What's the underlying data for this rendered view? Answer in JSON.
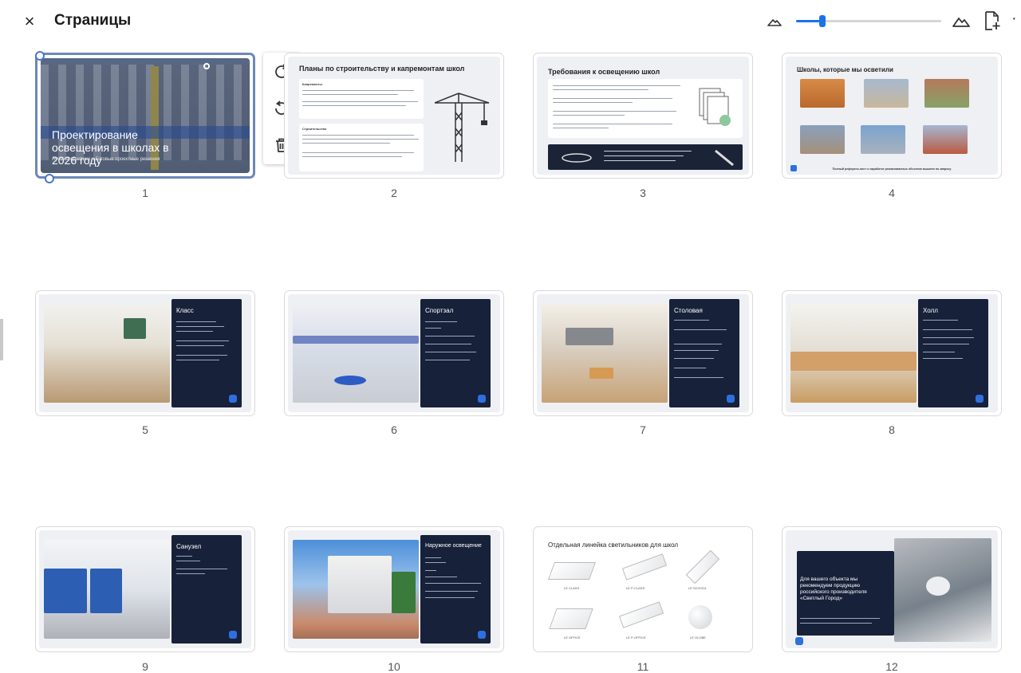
{
  "header": {
    "close_label": "×",
    "title": "Страницы",
    "zoom_level": 0.18
  },
  "menu": [
    "rotate-clockwise",
    "rotate-counterclockwise",
    "delete"
  ],
  "pages": [
    {
      "number": "1",
      "title": "Проектирование освещения в школах в 2026 году",
      "subtitle": "Лучшие практики и Готовые проектные решения"
    },
    {
      "number": "2",
      "title": "Планы по строительству и капремонтам школ",
      "sections": [
        "Капремонты",
        "Строительство"
      ]
    },
    {
      "number": "3",
      "title": "Требования к освещению школ"
    },
    {
      "number": "4",
      "title": "Школы, которые мы осветили",
      "footer": "Полный референс-лист о наработке реализованных объектов вышлем по запросу"
    },
    {
      "number": "5",
      "title": "Класс"
    },
    {
      "number": "6",
      "title": "Спортзал"
    },
    {
      "number": "7",
      "title": "Столовая"
    },
    {
      "number": "8",
      "title": "Холл"
    },
    {
      "number": "9",
      "title": "Санузел"
    },
    {
      "number": "10",
      "title": "Наружное освещение"
    },
    {
      "number": "11",
      "title": "Отдельная линейка светильников для школ",
      "lamps": [
        "LE CLASS",
        "LE P-CLASS",
        "LE SCHOOL",
        "LE OFFICE",
        "LE P-OFFICE",
        "LE GLOBE"
      ]
    },
    {
      "number": "12",
      "title": "Для вашего объекта мы рекомендуем продукцию российского производителя «Светлый Город»"
    }
  ]
}
